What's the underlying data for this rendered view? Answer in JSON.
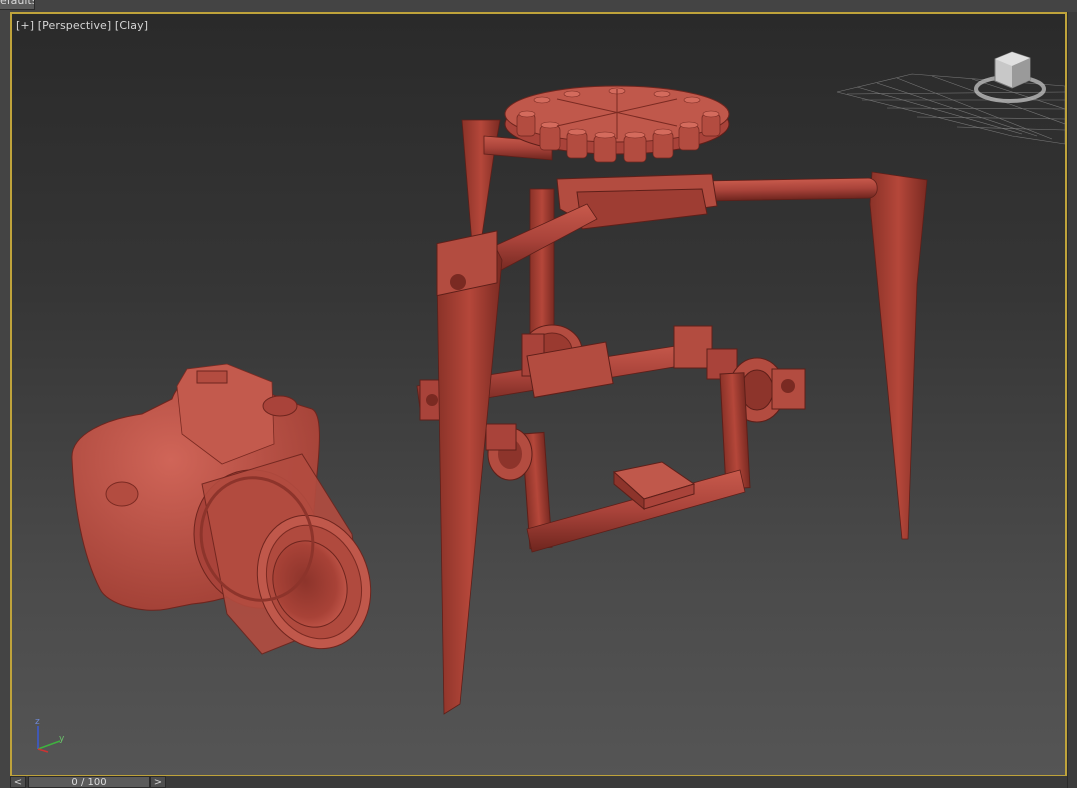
{
  "top_tab": {
    "label": "efaults"
  },
  "viewport": {
    "label_plus": "[+]",
    "label_view": "[Perspective]",
    "label_shading": "[Clay]",
    "border_color": "#bfa33b"
  },
  "axis": {
    "z": "z",
    "y": "y"
  },
  "timeline": {
    "prev": "<",
    "next": ">",
    "frame_text": "0 / 100"
  },
  "colors": {
    "model": "#b5473a",
    "model_dark": "#7e2d24",
    "model_light": "#cf6356"
  }
}
